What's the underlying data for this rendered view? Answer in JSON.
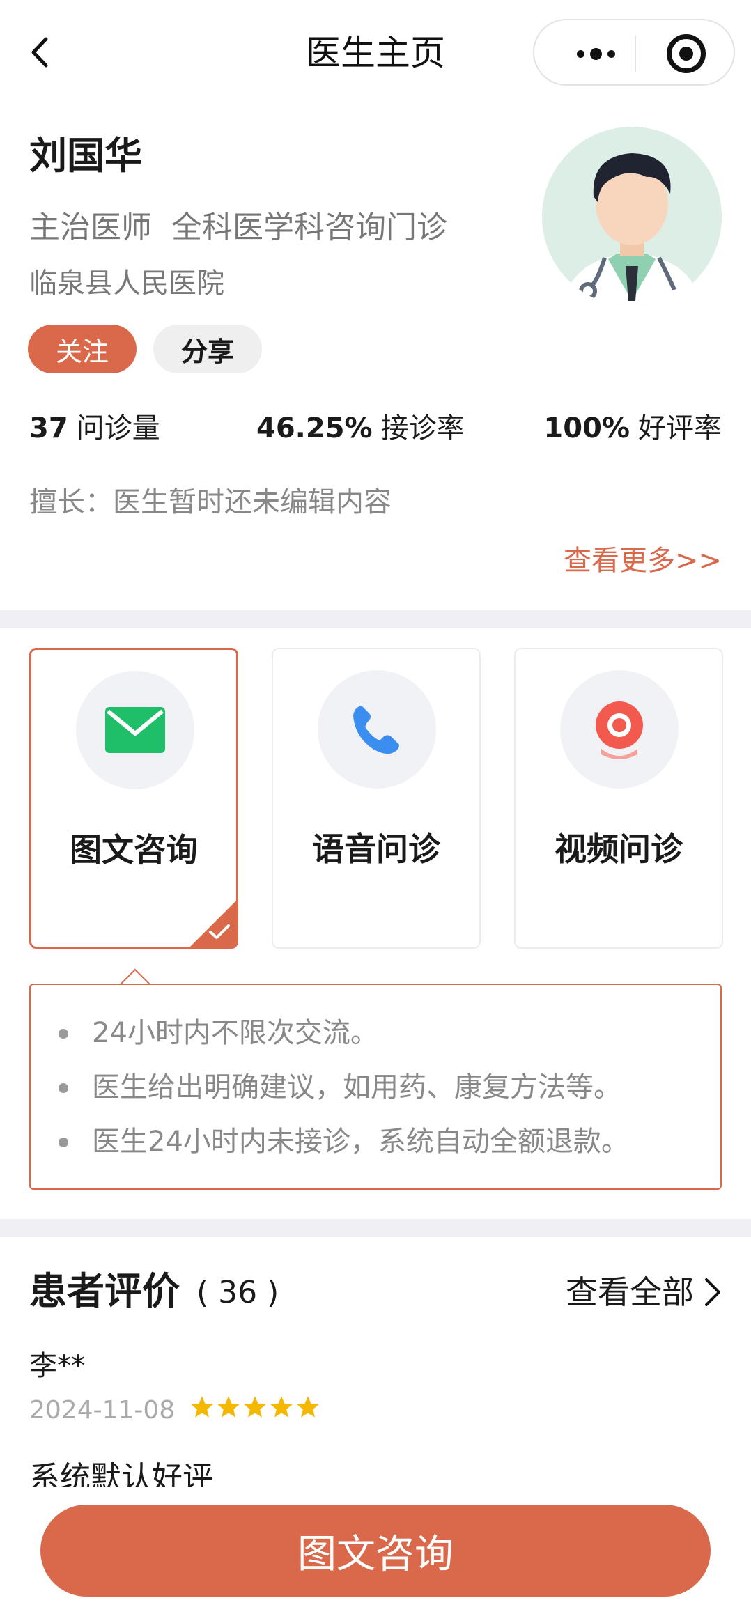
{
  "header": {
    "title": "医生主页",
    "icons": {
      "back": "chevron-left-icon",
      "more": "more-dots-icon",
      "close": "target-icon"
    }
  },
  "doctor": {
    "name": "刘国华",
    "title": "主治医师",
    "department": "全科医学科咨询门诊",
    "hospital": "临泉县人民医院",
    "follow_label": "关注",
    "share_label": "分享",
    "avatar_icon": "doctor-avatar-icon"
  },
  "stats": {
    "consultations_value": "37",
    "consultations_label": "问诊量",
    "acceptance_value": "46.25%",
    "acceptance_label": "接诊率",
    "rating_value": "100%",
    "rating_label": "好评率"
  },
  "specialty": "擅长：医生暂时还未编辑内容",
  "view_more": "查看更多>>",
  "services": [
    {
      "label": "图文咨询",
      "icon": "envelope-icon",
      "selected": true
    },
    {
      "label": "语音问诊",
      "icon": "phone-icon",
      "selected": false
    },
    {
      "label": "视频问诊",
      "icon": "camera-icon",
      "selected": false
    }
  ],
  "features": [
    "24小时内不限次交流。",
    "医生给出明确建议，如用药、康复方法等。",
    "医生24小时内未接诊，系统自动全额退款。"
  ],
  "reviews": {
    "title": "患者评价",
    "count": "( 36 )",
    "view_all": "查看全部",
    "items": [
      {
        "name": "李**",
        "date": "2024-11-08",
        "stars": 5,
        "text": "系统默认好评"
      }
    ]
  },
  "bottom_button": "图文咨询",
  "colors": {
    "accent": "#d9694a",
    "star": "#f5b800",
    "divider": "#f0f0f4"
  }
}
